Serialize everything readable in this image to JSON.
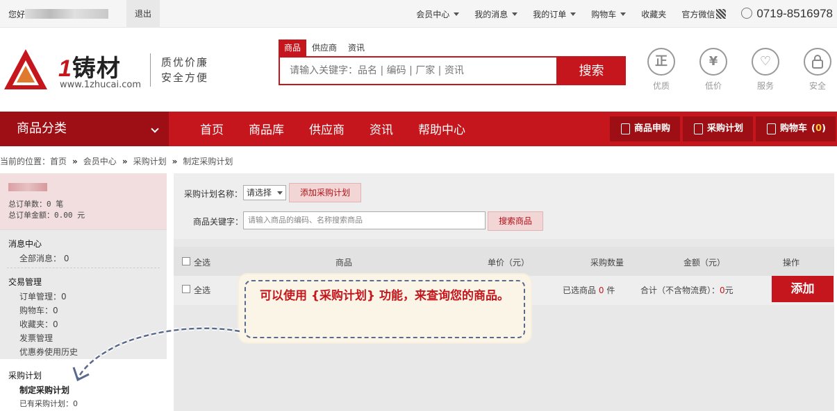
{
  "topbar": {
    "greeting": "您好",
    "logout": "退出",
    "links": [
      "会员中心",
      "我的消息",
      "我的订单",
      "购物车",
      "收藏夹",
      "官方微信"
    ],
    "phone": "0719-8516978"
  },
  "header": {
    "logo_text": "铸材",
    "logo_one": "1",
    "logo_url": "www.1zhucai.com",
    "slogan_line1": "质优价廉",
    "slogan_line2": "安全方便",
    "search_tabs": [
      "商品",
      "供应商",
      "资讯"
    ],
    "search_placeholder": "请输入关键字：品名 | 编码 | 厂家 | 资讯",
    "search_button": "搜索",
    "badges": [
      {
        "glyph": "正",
        "label": "优质",
        "icon": "quality-icon"
      },
      {
        "glyph": "¥",
        "label": "低价",
        "icon": "price-icon"
      },
      {
        "glyph": "♡",
        "label": "服务",
        "icon": "service-icon"
      },
      {
        "glyph": "🔒",
        "label": "安全",
        "icon": "lock-icon"
      }
    ]
  },
  "nav": {
    "category": "商品分类",
    "links": [
      "首页",
      "商品库",
      "供应商",
      "资讯",
      "帮助中心"
    ],
    "buttons": [
      "商品申购",
      "采购计划",
      "购物车"
    ],
    "cart_count": "0"
  },
  "breadcrumb": {
    "prefix": "当前的位置：",
    "items": [
      "首页",
      "会员中心",
      "采购计划",
      "制定采购计划"
    ]
  },
  "sidebar": {
    "total_orders": "总订单数：0 笔",
    "total_amount": "总订单金额：0.00 元",
    "message_center": "消息中心",
    "all_messages": "全部消息：  0",
    "trade_mgmt": "交易管理",
    "trade_items": [
      "订单管理：0",
      "购物车：0",
      "收藏夹：0",
      "发票管理",
      "优惠券使用历史"
    ],
    "purchase_plan": "采购计划",
    "make_plan": "制定采购计划",
    "existing_plans": "已有采购计划：0"
  },
  "main": {
    "plan_name_label": "采购计划名称：",
    "plan_select": "请选择",
    "add_plan_button": "添加采购计划",
    "keyword_label": "商品关键字：",
    "keyword_placeholder": "请输入商品的编码、名称搜索商品",
    "search_goods_button": "搜索商品",
    "headers": {
      "select_all": "全选",
      "goods": "商品",
      "price": "单价（元）",
      "qty": "采购数量",
      "amount": "金额（元）",
      "ops": "操作"
    },
    "footer_select_all": "全选",
    "selected_prefix": "已选商品",
    "selected_count": "0",
    "selected_unit": "件",
    "total_prefix": "合计（不含物流费）：",
    "total_value": "0",
    "total_unit": "元",
    "add_button": "添加"
  },
  "callout": {
    "text": "可以使用 {采购计划} 功能，来查询您的商品。"
  }
}
